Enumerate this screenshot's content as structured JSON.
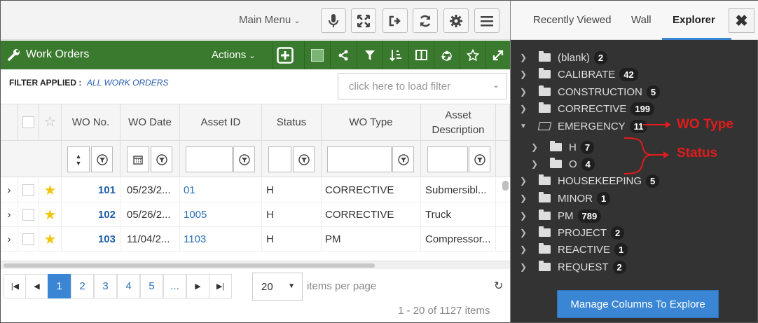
{
  "topbar": {
    "main_menu": "Main Menu"
  },
  "greenbar": {
    "title": "Work Orders",
    "actions": "Actions"
  },
  "filter": {
    "label": "FILTER APPLIED :",
    "value": "ALL WORK ORDERS",
    "placeholder": "click here to load filter"
  },
  "columns": [
    "WO No.",
    "WO Date",
    "Asset ID",
    "Status",
    "WO Type",
    "Asset Description"
  ],
  "rows": [
    {
      "wo": "101",
      "date": "05/23/2...",
      "asset": "01",
      "status": "H",
      "type": "CORRECTIVE",
      "desc": "Submersibl..."
    },
    {
      "wo": "102",
      "date": "05/26/2...",
      "asset": "1005",
      "status": "H",
      "type": "CORRECTIVE",
      "desc": "Truck"
    },
    {
      "wo": "103",
      "date": "11/04/2...",
      "asset": "1103",
      "status": "H",
      "type": "PM",
      "desc": "Compressor..."
    }
  ],
  "pager": {
    "pages": [
      "1",
      "2",
      "3",
      "4",
      "5",
      "..."
    ],
    "per_page": "20",
    "per_page_label": "items per page",
    "count": "1 - 20 of 1127 items"
  },
  "panel": {
    "tabs": [
      "Recently Viewed",
      "Wall",
      "Explorer"
    ],
    "tree": [
      {
        "label": "(blank)",
        "count": "2"
      },
      {
        "label": "CALIBRATE",
        "count": "42"
      },
      {
        "label": "CONSTRUCTION",
        "count": "5"
      },
      {
        "label": "CORRECTIVE",
        "count": "199"
      },
      {
        "label": "EMERGENCY",
        "count": "11",
        "expanded": true
      },
      {
        "label": "H",
        "count": "7",
        "child": true
      },
      {
        "label": "O",
        "count": "4",
        "child": true
      },
      {
        "label": "HOUSEKEEPING",
        "count": "5"
      },
      {
        "label": "MINOR",
        "count": "1"
      },
      {
        "label": "PM",
        "count": "789"
      },
      {
        "label": "PROJECT",
        "count": "2"
      },
      {
        "label": "REACTIVE",
        "count": "1"
      },
      {
        "label": "REQUEST",
        "count": "2"
      }
    ],
    "manage_button": "Manage Columns To Explore"
  },
  "annotations": {
    "wo_type": "WO Type",
    "status": "Status"
  }
}
